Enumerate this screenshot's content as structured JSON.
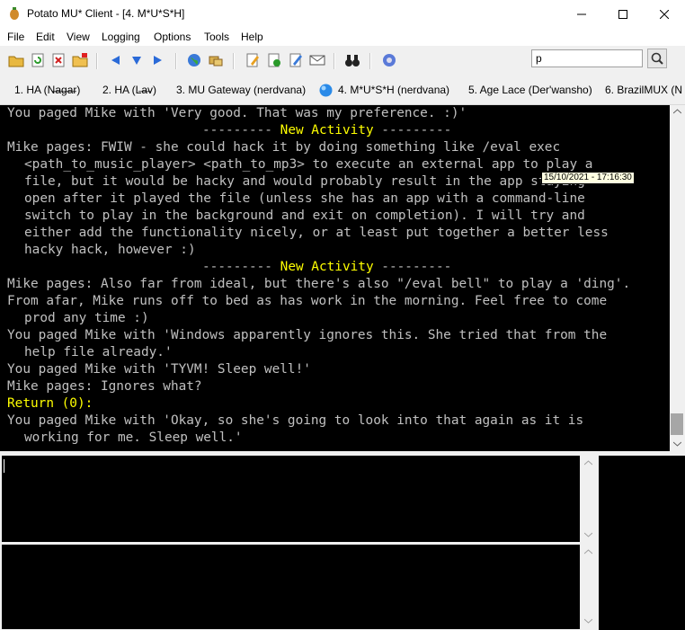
{
  "window": {
    "title": "Potato MU* Client - [4. M*U*S*H]"
  },
  "menu": [
    "File",
    "Edit",
    "View",
    "Logging",
    "Options",
    "Tools",
    "Help"
  ],
  "toolbar_icons": [
    "open-folder-icon",
    "refresh-icon",
    "close-world-icon",
    "folder-icon",
    "back-arrow-icon",
    "down-arrow-icon",
    "forward-arrow-icon",
    "globe-icon",
    "connect-icon",
    "edit-icon",
    "log-icon",
    "notes-icon",
    "mail-icon",
    "binoculars-icon",
    "settings-icon"
  ],
  "search": {
    "value": "p"
  },
  "tabs": [
    {
      "label": "1. HA (N̶a̶g̶a̶r)"
    },
    {
      "label": "2. HA (L̶a̶v)"
    },
    {
      "label": "3. MU Gateway (nerdvana)"
    },
    {
      "label": "4. M*U*S*H (nerdvana)"
    },
    {
      "label": "5. Age Lace (Der'wansho)"
    },
    {
      "label": "6. BrazilMUX (N"
    }
  ],
  "output": {
    "lines": [
      "You paged Mike with 'Very good. That was my preference. :)'",
      "--------- New Activity ---------",
      "Mike pages: FWIW - she could hack it by doing something like /eval exec",
      "<path_to_music_player> <path_to_mp3> to execute an external app to play a",
      "file, but it would be hacky and would probably result in the app staying",
      "open after it played the file (unless she has an app with a command-line",
      "switch to play in the background and exit on completion). I will try and",
      "either add the functionality nicely, or at least put together a better less",
      "hacky hack, however :)",
      "--------- New Activity ---------",
      "Mike pages: Also far from ideal, but there's also \"/eval bell\" to play a 'ding'.",
      "From afar, Mike runs off to bed as has work in the morning. Feel free to come",
      "prod any time :)",
      "You paged Mike with 'Windows apparently ignores this. She tried that from the",
      "help file already.'",
      "You paged Mike with 'TYVM! Sleep well!'",
      "Mike pages: Ignores what?",
      "Return (0):",
      "You paged Mike with 'Okay, so she's going to look into that again as it is",
      "working for me. Sleep well.'"
    ],
    "new_activity_label": "New Activity",
    "divider": "---------",
    "timestamp": "15/10/2021 - 17:16:30"
  },
  "colors": {
    "output_bg": "#000000",
    "output_text": "#c0c0c0",
    "highlight": "#ffff00"
  }
}
